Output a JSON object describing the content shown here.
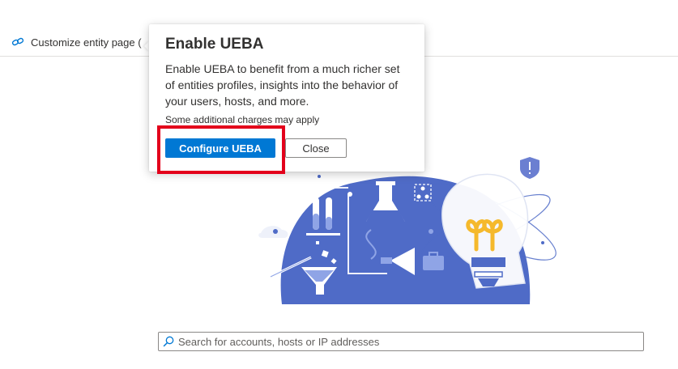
{
  "toolbar": {
    "customize_label": "Customize entity page (",
    "customize_icon": "link-chain-icon"
  },
  "bubble": {
    "title": "Enable UEBA",
    "body": "Enable UEBA to benefit from a much richer set of entities profiles, insights into the behavior of your users, hosts, and more.",
    "note": "Some additional charges may apply",
    "primary_label": "Configure UEBA",
    "secondary_label": "Close"
  },
  "search": {
    "placeholder": "Search for accounts, hosts or IP addresses",
    "value": "",
    "icon": "search-icon"
  },
  "colors": {
    "accent": "#0078d4",
    "illustration_blue": "#4f6bc7",
    "highlight_red": "#e3001b",
    "bulb_yellow": "#f5b92c"
  }
}
